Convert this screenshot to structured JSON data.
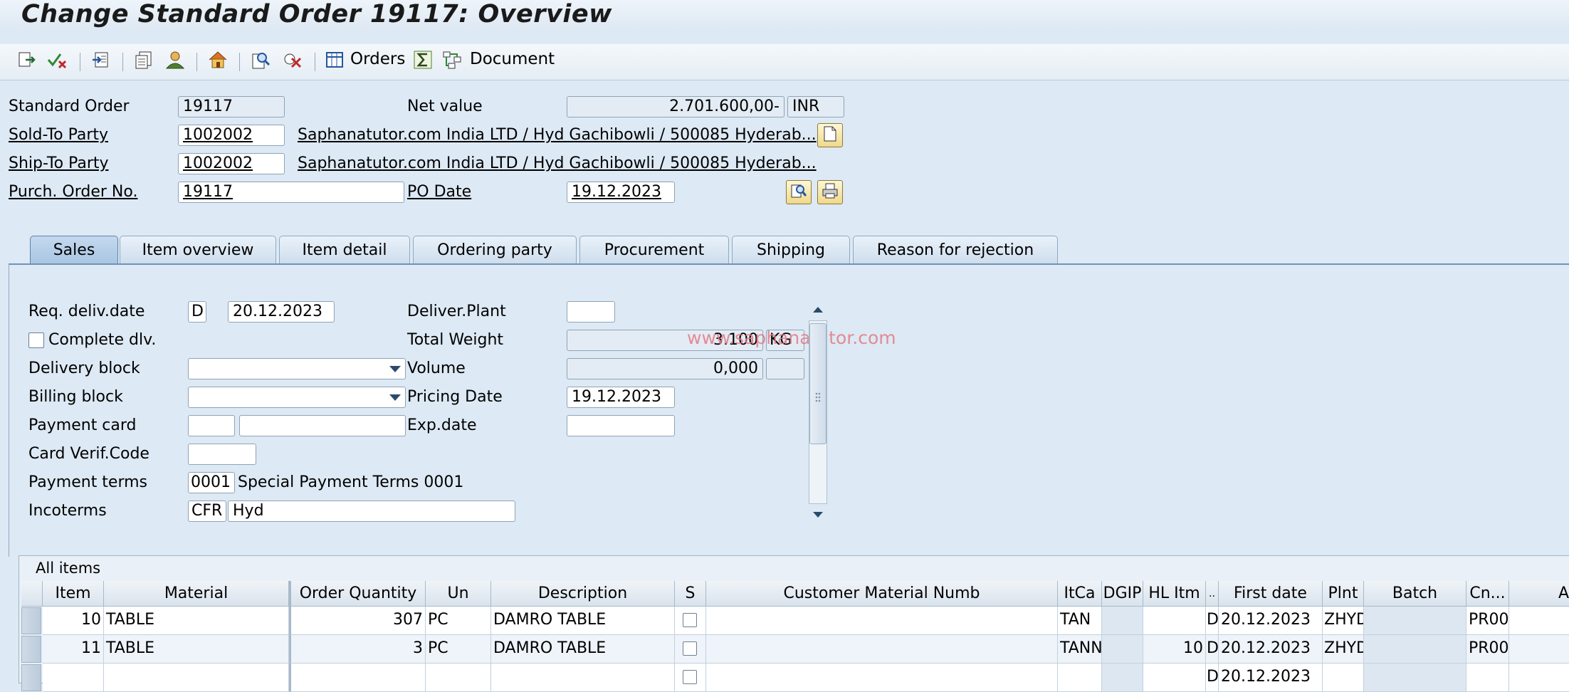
{
  "window": {
    "title": "Change Standard Order 19117: Overview"
  },
  "toolbar": {
    "icons": [
      "display-change-icon",
      "check-icon",
      "header-icon",
      "item-detail-icon",
      "business-partner-icon",
      "home-icon",
      "find-icon",
      "delete-icon"
    ],
    "orders_label": "Orders",
    "document_label": "Document"
  },
  "header": {
    "standard_order_label": "Standard Order",
    "standard_order_value": "19117",
    "net_value_label": "Net value",
    "net_value": "2.701.600,00-",
    "currency": "INR",
    "sold_to_label": "Sold-To Party",
    "sold_to_value": "1002002",
    "sold_to_desc": "Saphanatutor.com India LTD / Hyd Gachibowli / 500085 Hyderab...",
    "ship_to_label": "Ship-To Party",
    "ship_to_value": "1002002",
    "ship_to_desc": "Saphanatutor.com India LTD / Hyd Gachibowli / 500085 Hyderab...",
    "po_no_label": "Purch. Order No.",
    "po_no_value": "19117",
    "po_date_label": "PO Date",
    "po_date_value": "19.12.2023"
  },
  "tabs": [
    {
      "label": "Sales",
      "active": true
    },
    {
      "label": "Item overview"
    },
    {
      "label": "Item detail"
    },
    {
      "label": "Ordering party"
    },
    {
      "label": "Procurement"
    },
    {
      "label": "Shipping"
    },
    {
      "label": "Reason for rejection"
    }
  ],
  "sales": {
    "req_deliv_label": "Req. deliv.date",
    "req_deliv_type": "D",
    "req_deliv_date": "20.12.2023",
    "complete_dlv_label": "Complete dlv.",
    "delivery_block_label": "Delivery block",
    "billing_block_label": "Billing block",
    "payment_card_label": "Payment card",
    "card_verif_label": "Card Verif.Code",
    "payment_terms_label": "Payment terms",
    "payment_terms_code": "0001",
    "payment_terms_desc": "Special Payment Terms 0001",
    "incoterms_label": "Incoterms",
    "incoterms_code": "CFR",
    "incoterms_place": "Hyd",
    "deliver_plant_label": "Deliver.Plant",
    "total_weight_label": "Total Weight",
    "total_weight_value": "3.100",
    "weight_unit": "KG",
    "volume_label": "Volume",
    "volume_value": "0,000",
    "pricing_date_label": "Pricing Date",
    "pricing_date_value": "19.12.2023",
    "exp_date_label": "Exp.date",
    "watermark": "www.saphanatutor.com"
  },
  "items": {
    "title": "All items",
    "columns": [
      "Item",
      "Material",
      "Order Quantity",
      "Un",
      "Description",
      "S",
      "Customer Material Numb",
      "ItCa",
      "DGIP",
      "HL Itm",
      "..",
      "First date",
      "Plnt",
      "Batch",
      "Cn...",
      "A"
    ],
    "rows": [
      {
        "item": "10",
        "material": "TABLE",
        "qty": "307",
        "un": "PC",
        "desc": "DAMRO TABLE",
        "itca": "TAN",
        "hl": "",
        "d": "D",
        "first_date": "20.12.2023",
        "plnt": "ZHYD",
        "cn": "PR00"
      },
      {
        "item": "11",
        "material": "TABLE",
        "qty": "3",
        "un": "PC",
        "desc": "DAMRO TABLE",
        "itca": "TANN",
        "hl": "10",
        "d": "D",
        "first_date": "20.12.2023",
        "plnt": "ZHYD",
        "cn": "PR00"
      },
      {
        "item": "",
        "material": "",
        "qty": "",
        "un": "",
        "desc": "",
        "itca": "",
        "hl": "",
        "d": "D",
        "first_date": "20.12.2023",
        "plnt": "",
        "cn": ""
      }
    ]
  }
}
